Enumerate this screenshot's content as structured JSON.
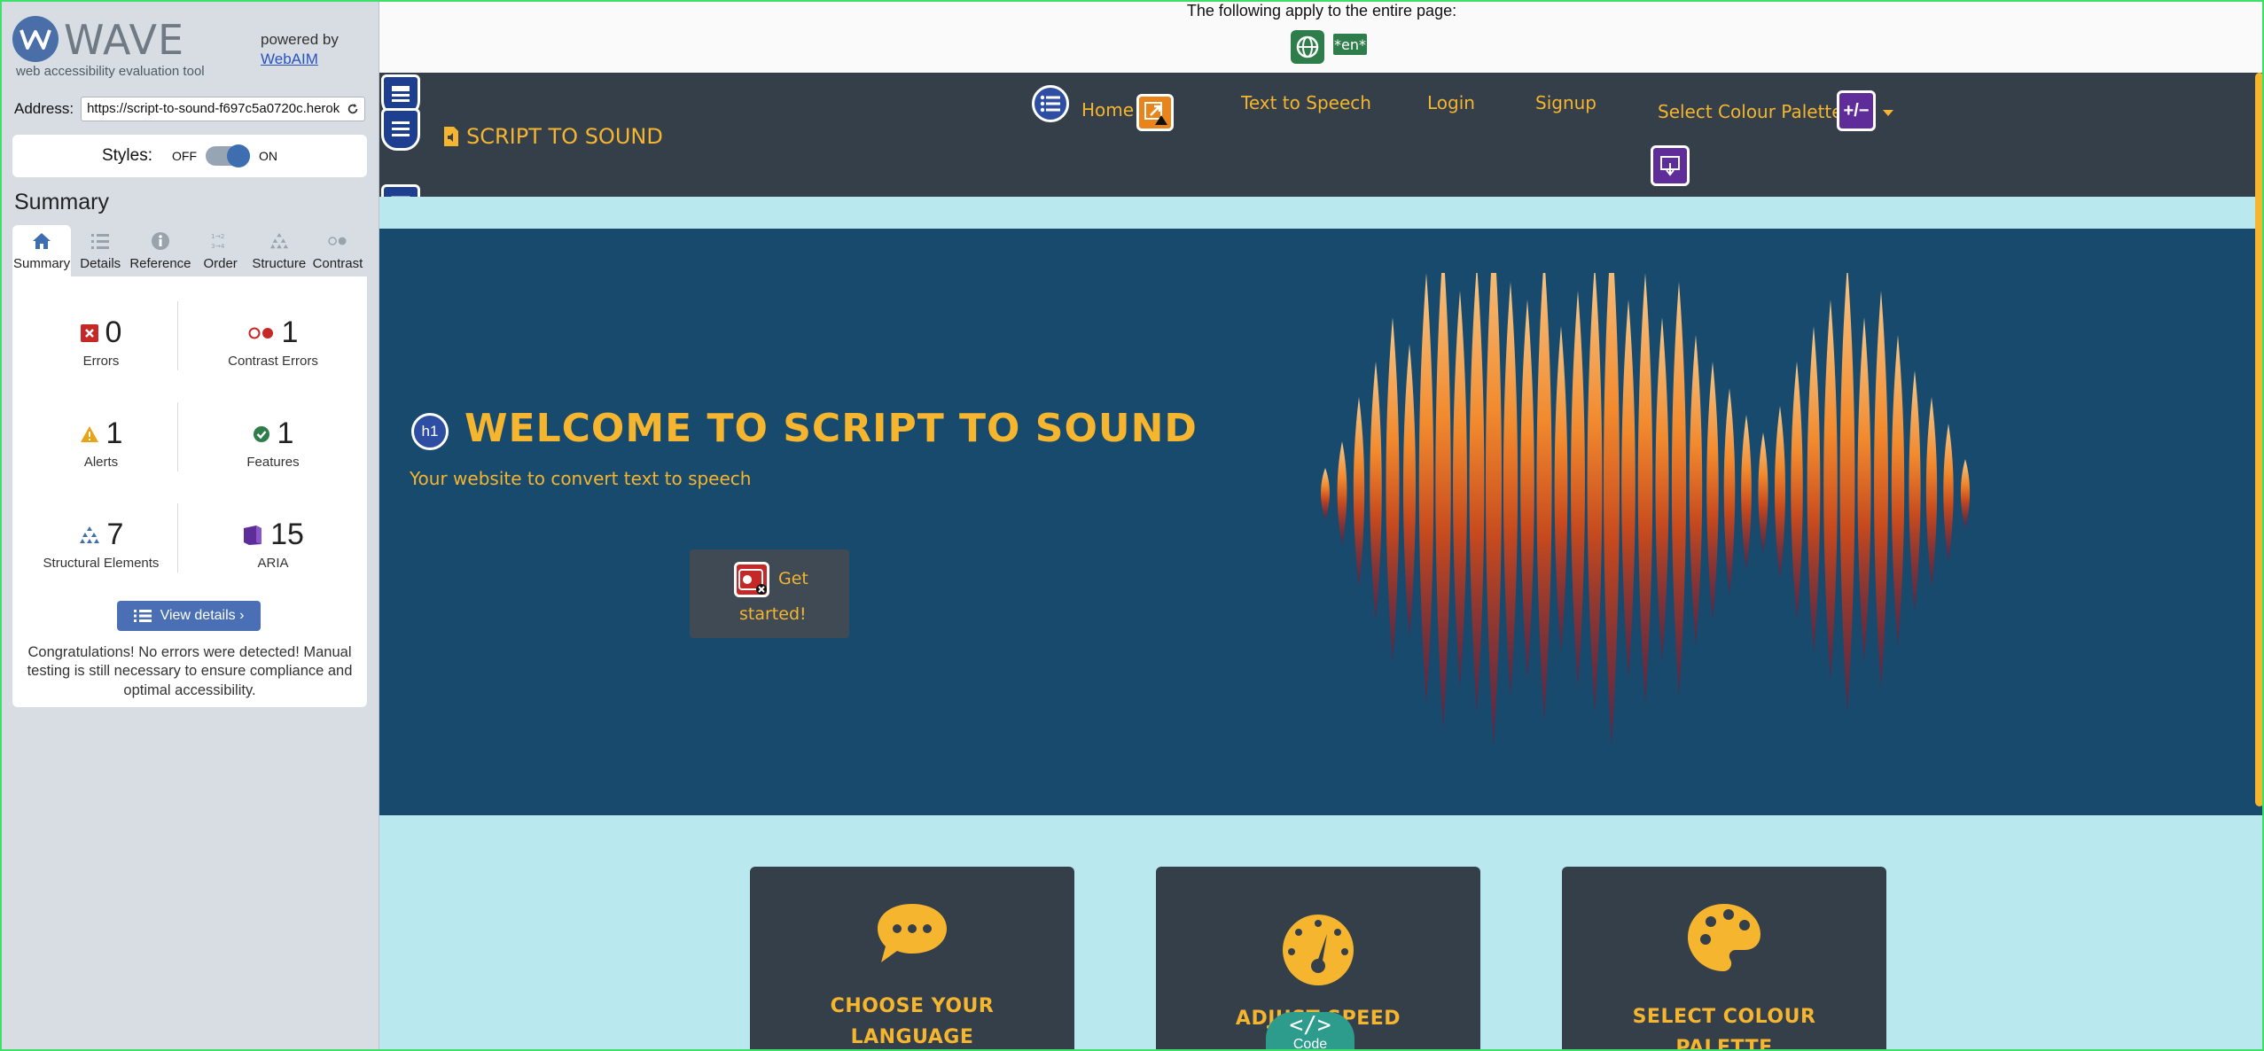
{
  "wave": {
    "brand": "WAVE",
    "tagline": "web accessibility evaluation tool",
    "powered_by": "powered by",
    "webaim_link": "WebAIM",
    "address_label": "Address:",
    "address_value": "https://script-to-sound-f697c5a0720c.herok",
    "styles_label": "Styles:",
    "styles_off": "OFF",
    "styles_on": "ON",
    "summary_title": "Summary",
    "tabs": [
      {
        "label": "Summary",
        "icon": "home-icon"
      },
      {
        "label": "Details",
        "icon": "list-icon"
      },
      {
        "label": "Reference",
        "icon": "info-icon"
      },
      {
        "label": "Order",
        "icon": "order-icon"
      },
      {
        "label": "Structure",
        "icon": "structure-icon"
      },
      {
        "label": "Contrast",
        "icon": "contrast-icon"
      }
    ],
    "stats": [
      {
        "value": "0",
        "label": "Errors",
        "color": "#c62828"
      },
      {
        "value": "1",
        "label": "Contrast Errors",
        "color": "#c62828"
      },
      {
        "value": "1",
        "label": "Alerts",
        "color": "#e8a317"
      },
      {
        "value": "1",
        "label": "Features",
        "color": "#2e7d4a"
      },
      {
        "value": "7",
        "label": "Structural Elements",
        "color": "#3d6fb0"
      },
      {
        "value": "15",
        "label": "ARIA",
        "color": "#5f2d9a"
      }
    ],
    "view_details": "View details ›",
    "congrats": "Congratulations! No errors were detected! Manual testing is still necessary to ensure compliance and optimal accessibility."
  },
  "page": {
    "global_notice": "The following apply to the entire page:",
    "lang_badge": "*en*",
    "site_name": "SCRIPT TO SOUND",
    "nav": {
      "home": "Home",
      "tts": "Text to Speech",
      "login": "Login",
      "signup": "Signup",
      "palette": "Select Colour Palette"
    },
    "aria_badge": "+/−",
    "hero": {
      "h1_badge": "h1",
      "title": "WELCOME TO SCRIPT TO SOUND",
      "subtitle": "Your website to convert text to speech",
      "button_line1": "Get",
      "button_line2": "started!"
    },
    "cards": [
      {
        "title_line1": "CHOOSE YOUR",
        "title_line2": "LANGUAGE",
        "icon": "speech-bubble-icon"
      },
      {
        "title_line1": "ADJUST SPEED",
        "icon": "speedometer-icon"
      },
      {
        "title_line1": "SELECT COLOUR",
        "title_line2": "PALETTE",
        "icon": "palette-icon"
      }
    ],
    "code_tab": "Code",
    "code_glyph": "</>"
  },
  "colors": {
    "accent": "#f5b52e",
    "navbar": "#343f4a",
    "hero": "#184a6d",
    "page_bg": "#b9e8ef",
    "wave_blue": "#4a6fb5"
  }
}
